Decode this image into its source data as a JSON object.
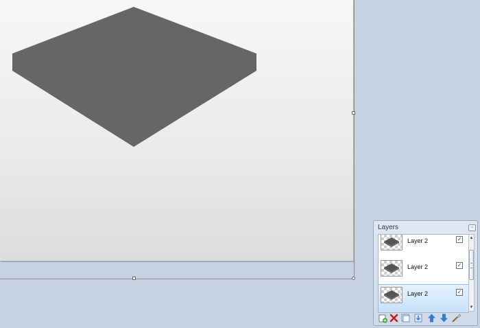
{
  "layers_panel": {
    "title": "Layers",
    "layers": [
      {
        "name": "Layer 2",
        "visible": true,
        "selected": false
      },
      {
        "name": "Layer 2",
        "visible": true,
        "selected": false
      },
      {
        "name": "Layer 2",
        "visible": true,
        "selected": true
      }
    ],
    "toolbar_icons": [
      "add-layer-icon",
      "delete-layer-icon",
      "duplicate-layer-icon",
      "merge-layer-down-icon",
      "move-layer-up-icon",
      "move-layer-down-icon",
      "layer-properties-icon"
    ]
  },
  "canvas": {
    "shape": "isometric-slab",
    "shape_color": "#666666",
    "background_gradient": [
      "#f7f7f7",
      "#dcdcdc"
    ]
  },
  "colors": {
    "workspace": "#c6d1e1",
    "selection_highlight": "#c7e1fb",
    "delete_icon": "#cc1b1b",
    "arrow_icon": "#2d7fd6",
    "add_icon": "#3a9b3a"
  }
}
